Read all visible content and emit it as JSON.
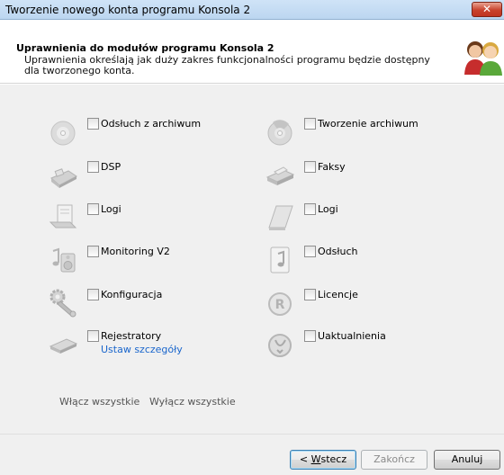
{
  "window": {
    "title": "Tworzenie nowego konta programu Konsola 2",
    "close_label": "✕"
  },
  "header": {
    "title": "Uprawnienia do modułów programu Konsola 2",
    "description": "Uprawnienia określają jak duży zakres funkcjonalności programu będzie dostępny dla tworzonego konta."
  },
  "permissions": {
    "left": [
      {
        "label": "Odsłuch z archiwum",
        "icon": "cd-disc-icon",
        "checked": false
      },
      {
        "label": "DSP",
        "icon": "fax-machine-icon",
        "checked": false
      },
      {
        "label": "Logi",
        "icon": "log-document-icon",
        "checked": false
      },
      {
        "label": "Monitoring V2",
        "icon": "music-speaker-icon",
        "checked": false
      },
      {
        "label": "Konfiguracja",
        "icon": "wrench-gear-icon",
        "checked": false
      },
      {
        "label": "Rejestratory",
        "icon": "recorder-device-icon",
        "checked": false,
        "link": "Ustaw szczegóły"
      }
    ],
    "right": [
      {
        "label": "Tworzenie archiwum",
        "icon": "cd-burn-icon",
        "checked": false
      },
      {
        "label": "Faksy",
        "icon": "fax-paper-icon",
        "checked": false
      },
      {
        "label": "Logi",
        "icon": "notepad-icon",
        "checked": false
      },
      {
        "label": "Odsłuch",
        "icon": "music-note-icon",
        "checked": false
      },
      {
        "label": "Licencje",
        "icon": "registered-icon",
        "checked": false
      },
      {
        "label": "Uaktualnienia",
        "icon": "update-globe-icon",
        "checked": false
      }
    ]
  },
  "bulk": {
    "select_all": "Włącz wszystkie",
    "deselect_all": "Wyłącz wszystkie"
  },
  "buttons": {
    "back_prefix": "< ",
    "back_accel": "W",
    "back_rest": "stecz",
    "finish": "Zakończ",
    "cancel": "Anuluj"
  }
}
